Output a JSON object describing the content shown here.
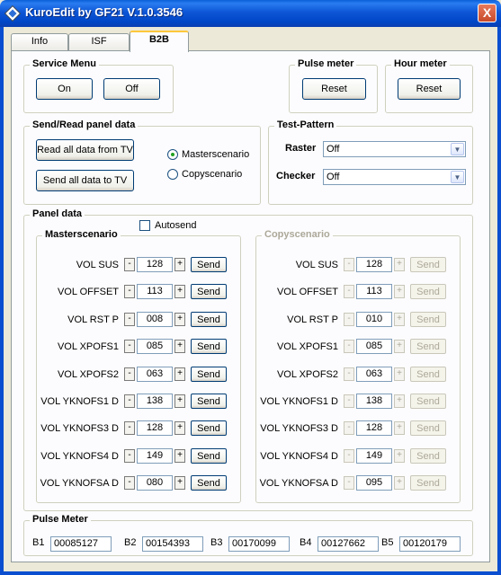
{
  "window": {
    "title": "KuroEdit by GF21 V.1.0.3546",
    "close_label": "X"
  },
  "tabs": [
    {
      "label": "Info"
    },
    {
      "label": "ISF"
    },
    {
      "label": "B2B"
    }
  ],
  "service_menu": {
    "title": "Service Menu",
    "on_label": "On",
    "off_label": "Off"
  },
  "pulse_meter_group": {
    "title": "Pulse meter",
    "reset_label": "Reset"
  },
  "hour_meter_group": {
    "title": "Hour meter",
    "reset_label": "Reset"
  },
  "send_read": {
    "title": "Send/Read panel data",
    "read_label": "Read all data from TV",
    "send_label": "Send all data to TV",
    "options": [
      "Masterscenario",
      "Copyscenario"
    ],
    "selected": "Masterscenario"
  },
  "test_pattern": {
    "title": "Test-Pattern",
    "raster_label": "Raster",
    "raster_value": "Off",
    "checker_label": "Checker",
    "checker_value": "Off"
  },
  "panel_data": {
    "title": "Panel data",
    "autosend_label": "Autosend",
    "autosend_checked": false,
    "master": {
      "title": "Masterscenario",
      "rows": [
        {
          "label": "VOL SUS",
          "value": "128"
        },
        {
          "label": "VOL OFFSET",
          "value": "113"
        },
        {
          "label": "VOL RST P",
          "value": "008"
        },
        {
          "label": "VOL XPOFS1",
          "value": "085"
        },
        {
          "label": "VOL XPOFS2",
          "value": "063"
        },
        {
          "label": "VOL YKNOFS1 D",
          "value": "138"
        },
        {
          "label": "VOL YKNOFS3 D",
          "value": "128"
        },
        {
          "label": "VOL YKNOFS4 D",
          "value": "149"
        },
        {
          "label": "VOL YKNOFSA D",
          "value": "080"
        }
      ]
    },
    "copy": {
      "title": "Copyscenario",
      "rows": [
        {
          "label": "VOL SUS",
          "value": "128"
        },
        {
          "label": "VOL OFFSET",
          "value": "113"
        },
        {
          "label": "VOL RST P",
          "value": "010"
        },
        {
          "label": "VOL XPOFS1",
          "value": "085"
        },
        {
          "label": "VOL XPOFS2",
          "value": "063"
        },
        {
          "label": "VOL YKNOFS1 D",
          "value": "138"
        },
        {
          "label": "VOL YKNOFS3 D",
          "value": "128"
        },
        {
          "label": "VOL YKNOFS4 D",
          "value": "149"
        },
        {
          "label": "VOL YKNOFSA D",
          "value": "095"
        }
      ]
    },
    "minus_label": "-",
    "plus_label": "+",
    "send_label": "Send"
  },
  "pulse_meter": {
    "title": "Pulse Meter",
    "blocks": [
      {
        "label": "B1",
        "value": "00085127"
      },
      {
        "label": "B2",
        "value": "00154393"
      },
      {
        "label": "B3",
        "value": "00170099"
      },
      {
        "label": "B4",
        "value": "00127662"
      },
      {
        "label": "B5",
        "value": "00120179"
      }
    ]
  },
  "colors": {
    "titlebar": "#0d56d6",
    "window_bg": "#ece9d8",
    "panel_bg": "#fcfcfe",
    "disabled_text": "#aca899"
  }
}
